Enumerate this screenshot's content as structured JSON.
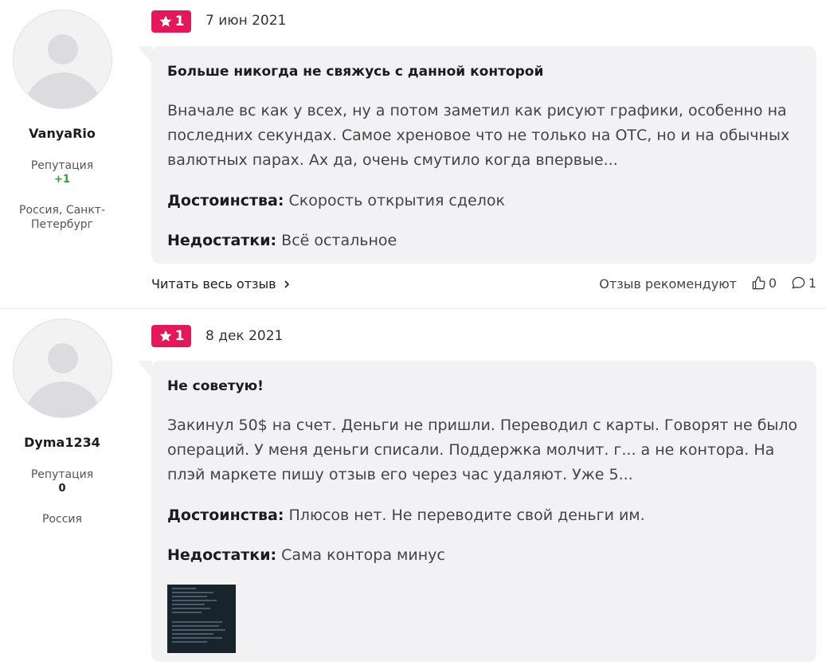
{
  "reviews": [
    {
      "author": "VanyaRio",
      "reputation_label": "Репутация",
      "reputation_value": "+1",
      "location": "Россия, Санкт-Петербург",
      "rating": "1",
      "date": "7 июн 2021",
      "title": "Больше никогда не свяжусь с данной конторой",
      "text": "Вначале вс как у всех, ну а потом заметил как рисуют графики, особенно на последних секундах. Самое хреновое что не только на ОТС, но и на обычных валютных парах. Ах да, очень смутило когда впервые...",
      "pros_label": "Достоинства:",
      "pros": "Скорость открытия сделок",
      "cons_label": "Недостатки:",
      "cons": "Всё остальное",
      "read_more": "Читать весь отзыв",
      "recommend_label": "Отзыв рекомендуют",
      "likes": "0",
      "comments": "1"
    },
    {
      "author": "Dyma1234",
      "reputation_label": "Репутация",
      "reputation_value": "0",
      "location": "Россия",
      "rating": "1",
      "date": "8 дек 2021",
      "title": "Не советую!",
      "text": "Закинул 50$ на счет. Деньги не пришли. Переводил с карты. Говорят не было операций. У меня деньги списали. Поддержка молчит. г... а не контора. На плэй маркете пишу отзыв его через час удаляют. Уже 5...",
      "pros_label": "Достоинства:",
      "pros": "Плюсов нет. Не переводите свой деньги им.",
      "cons_label": "Недостатки:",
      "cons": "Сама контора минус"
    }
  ],
  "colors": {
    "rating_badge": "#e2185b",
    "reputation_positive": "#2ea135",
    "bubble_bg": "#f2f2f5"
  },
  "icons": {
    "rating": "star-icon",
    "read_more": "chevron-right-icon",
    "likes": "thumbs-up-icon",
    "comments": "comment-icon"
  }
}
